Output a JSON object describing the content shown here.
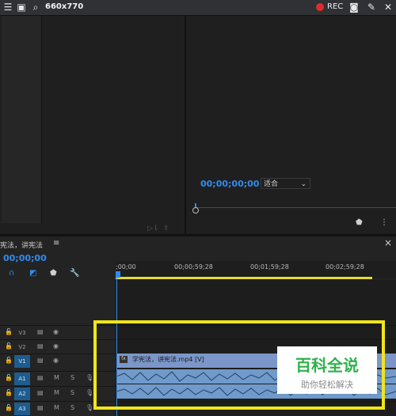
{
  "recorder": {
    "dimensions": "660x770",
    "rec_label": "REC"
  },
  "program_monitor": {
    "timecode": "00;00;00;00",
    "fit_value": "适合"
  },
  "timeline": {
    "sequence_name": "宪法，讲宪法",
    "timecode": "00;00;00",
    "ruler_ticks": [
      ";00;00",
      "00;00;59;28",
      "00;01;59;28",
      "00;02;59;28"
    ],
    "tracks": [
      {
        "name": "V3",
        "type": "video",
        "targeted": false
      },
      {
        "name": "V2",
        "type": "video",
        "targeted": false
      },
      {
        "name": "V1",
        "type": "video",
        "targeted": true
      },
      {
        "name": "A1",
        "type": "audio",
        "targeted": true
      },
      {
        "name": "A2",
        "type": "audio",
        "targeted": true
      },
      {
        "name": "A3",
        "type": "audio",
        "targeted": true
      }
    ],
    "track_buttons": {
      "mute": "M",
      "solo": "S"
    },
    "video_clip_label": "学宪法，讲宪法.mp4 [V]"
  },
  "watermark": {
    "title": "百科全说",
    "subtitle": "助你轻松解决"
  },
  "colors": {
    "accent": "#2f8cf0",
    "highlight": "#f0e51c",
    "rec": "#e02b2b",
    "video_clip": "#7b96c9",
    "audio_clip": "#6f9acb",
    "watermark_green": "#2fb14a"
  }
}
